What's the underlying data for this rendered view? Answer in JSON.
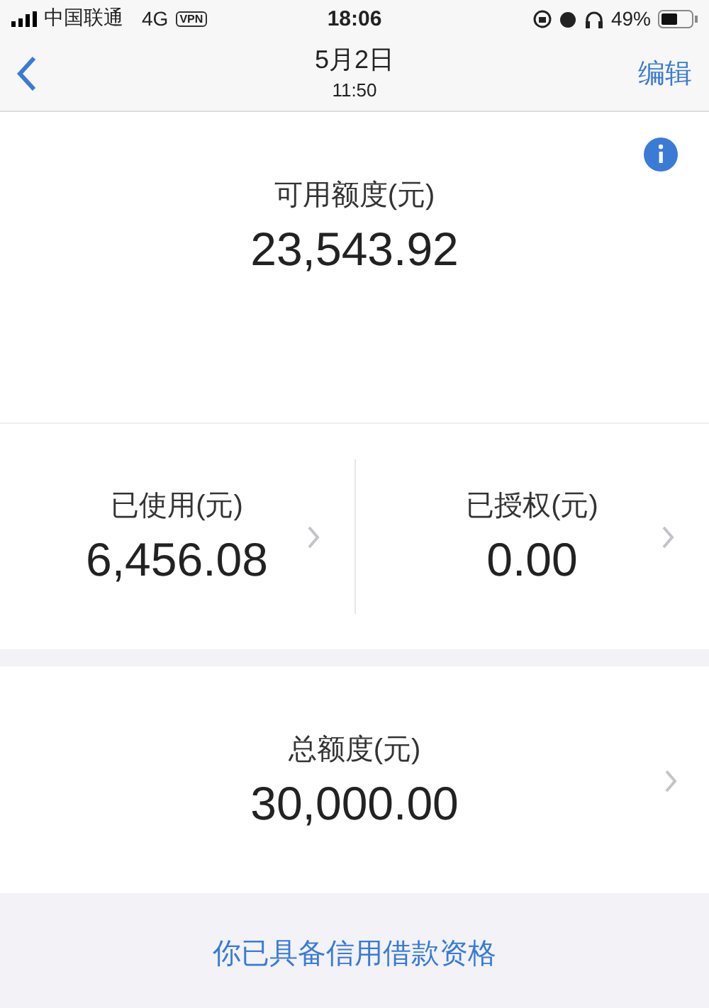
{
  "status_bar": {
    "carrier": "中国联通",
    "network": "4G",
    "vpn": "VPN",
    "time": "18:06",
    "battery": "49%"
  },
  "nav": {
    "title": "5月2日",
    "subtitle": "11:50",
    "action": "编辑"
  },
  "available": {
    "label": "可用额度(元)",
    "amount": "23,543.92"
  },
  "stats": [
    {
      "label": "已使用(元)",
      "amount": "6,456.08"
    },
    {
      "label": "已授权(元)",
      "amount": "0.00"
    }
  ],
  "total": {
    "label": "总额度(元)",
    "amount": "30,000.00"
  },
  "footer_link": "你已具备信用借款资格"
}
